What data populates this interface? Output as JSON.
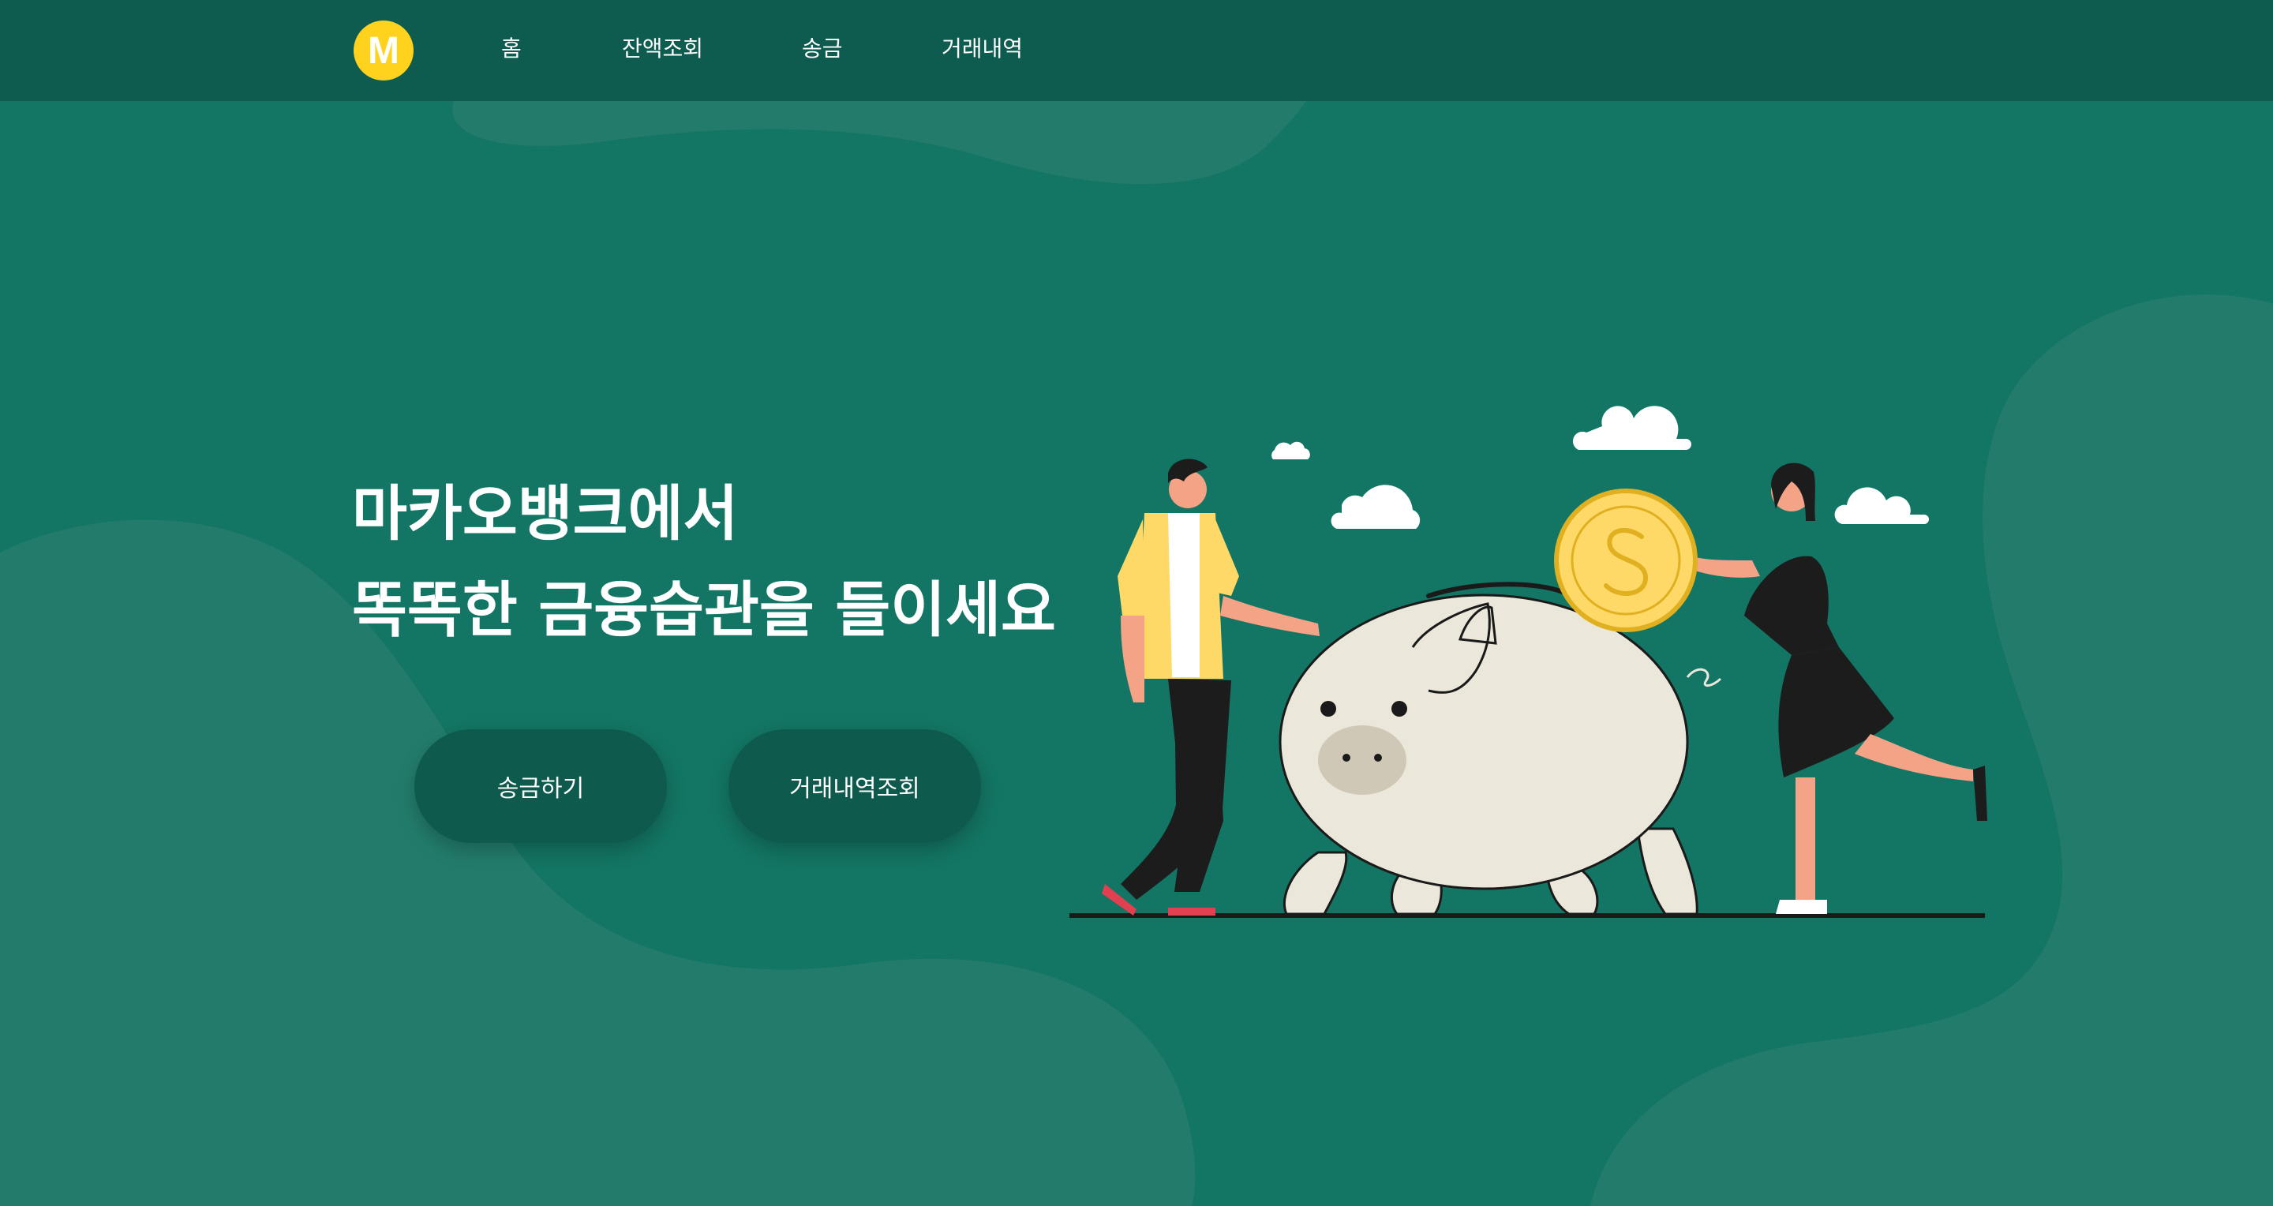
{
  "header": {
    "logo_letter": "M",
    "nav": [
      {
        "label": "홈"
      },
      {
        "label": "잔액조회"
      },
      {
        "label": "송금"
      },
      {
        "label": "거래내역"
      }
    ]
  },
  "hero": {
    "title_line1": "마카오뱅크에서",
    "title_line2": "똑똑한 금융습관을 들이세요",
    "buttons": {
      "transfer": "송금하기",
      "history": "거래내역조회"
    }
  },
  "colors": {
    "background": "#137563",
    "header": "#0d5c4f",
    "blob": "#237c6b",
    "button": "#0e5a4d",
    "logo": "#ffd21e",
    "text": "#ffffff"
  },
  "illustration": {
    "subject": "piggy-bank-with-man-and-woman-inserting-coin"
  }
}
